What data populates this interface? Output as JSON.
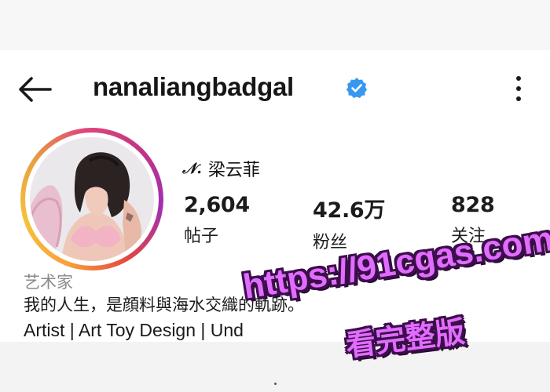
{
  "header": {
    "username": "nanaliangbadgal",
    "verified_color": "#3897f0"
  },
  "profile": {
    "name_mark": "𝒩.",
    "full_name": "梁云菲",
    "stats": [
      {
        "value": "2,604",
        "label": "帖子"
      },
      {
        "value": "42.6万",
        "label": "粉丝"
      },
      {
        "value": "828",
        "label": "关注"
      }
    ],
    "category": "艺术家",
    "bio_line1": "我的人生，是顔料與海水交織的軌跡。",
    "bio_line2": "Artist | Art Toy Design  | Und"
  },
  "watermark": {
    "url": "https://91cgas.com",
    "text": "看完整版"
  },
  "icons": {
    "back": "arrow-left-icon",
    "more": "more-vertical-icon",
    "verified": "verified-badge-icon"
  }
}
